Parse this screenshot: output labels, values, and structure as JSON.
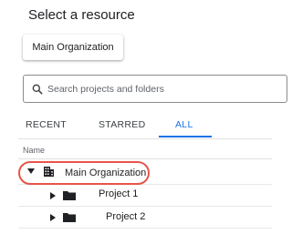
{
  "dialog": {
    "title": "Select a resource"
  },
  "org_picker": {
    "label": "Main Organization"
  },
  "search": {
    "placeholder": "Search projects and folders",
    "icon": "search-icon"
  },
  "tabs": [
    {
      "label": "RECENT",
      "active": false
    },
    {
      "label": "STARRED",
      "active": false
    },
    {
      "label": "ALL",
      "active": true
    }
  ],
  "table": {
    "header": "Name",
    "rows": [
      {
        "label": "Main Organization",
        "icon": "building-icon",
        "expanded": true,
        "highlighted": true
      },
      {
        "label": "Project 1",
        "icon": "folder-icon",
        "expanded": false
      },
      {
        "label": "Project 2",
        "icon": "folder-icon",
        "expanded": false
      }
    ]
  },
  "colors": {
    "accent": "#1a73e8",
    "highlight_ring": "#e8554a",
    "text": "#202124"
  }
}
